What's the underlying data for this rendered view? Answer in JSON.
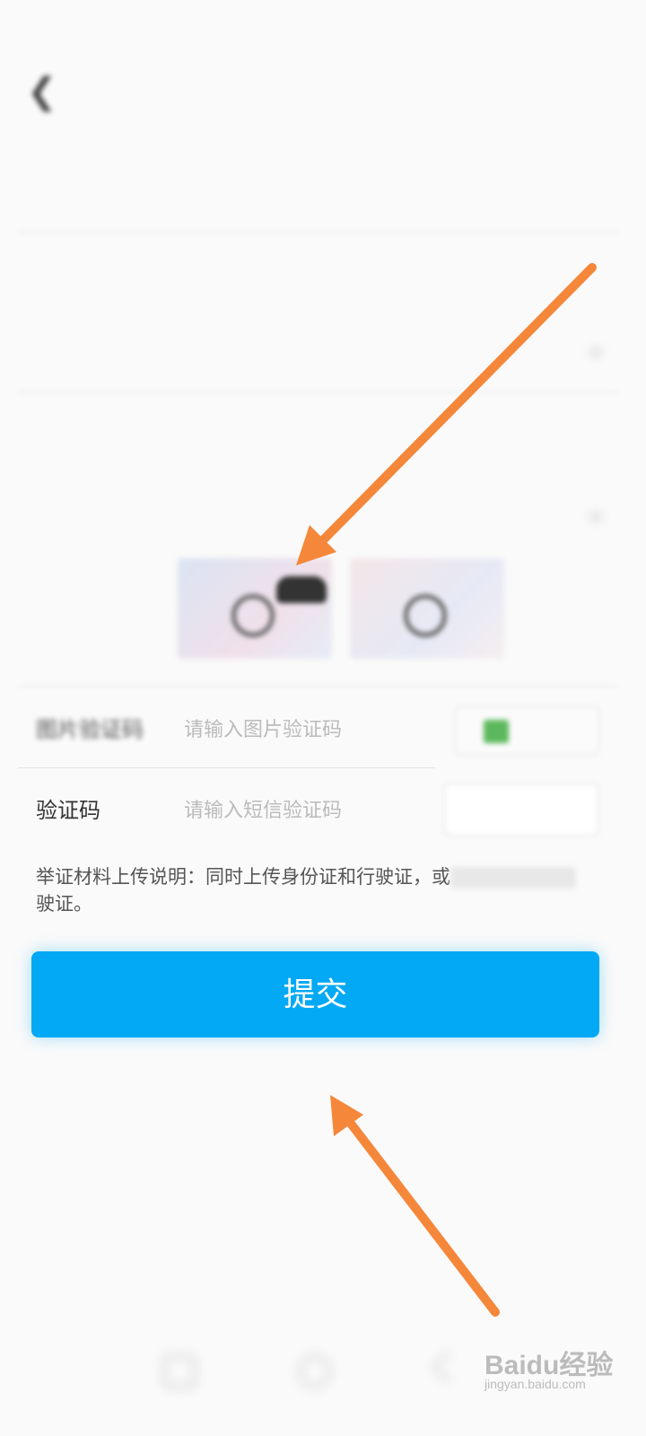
{
  "status_bar": {
    "time": "",
    "icons": ""
  },
  "nav": {
    "back_icon": "back-chevron-icon",
    "title": ""
  },
  "form": {
    "rows": [
      {
        "label": "",
        "value": ""
      },
      {
        "label": "",
        "value": ""
      },
      {
        "label": "",
        "value": ""
      },
      {
        "label": "",
        "value": ""
      },
      {
        "label": "",
        "value": ""
      }
    ],
    "captcha": {
      "label": "图片验证码",
      "placeholder": "请输入图片验证码"
    },
    "sms": {
      "label": "验证码",
      "placeholder": "请输入短信验证码",
      "button": ""
    },
    "note": "举证材料上传说明：同时上传身份证和行驶证，或",
    "note_tail": "驶证。",
    "submit": "提交"
  },
  "colors": {
    "accent": "#03a9f4",
    "arrow": "#f5873a"
  },
  "watermark": {
    "brand": "Baidu经验",
    "sub": "jingyan.baidu.com"
  }
}
